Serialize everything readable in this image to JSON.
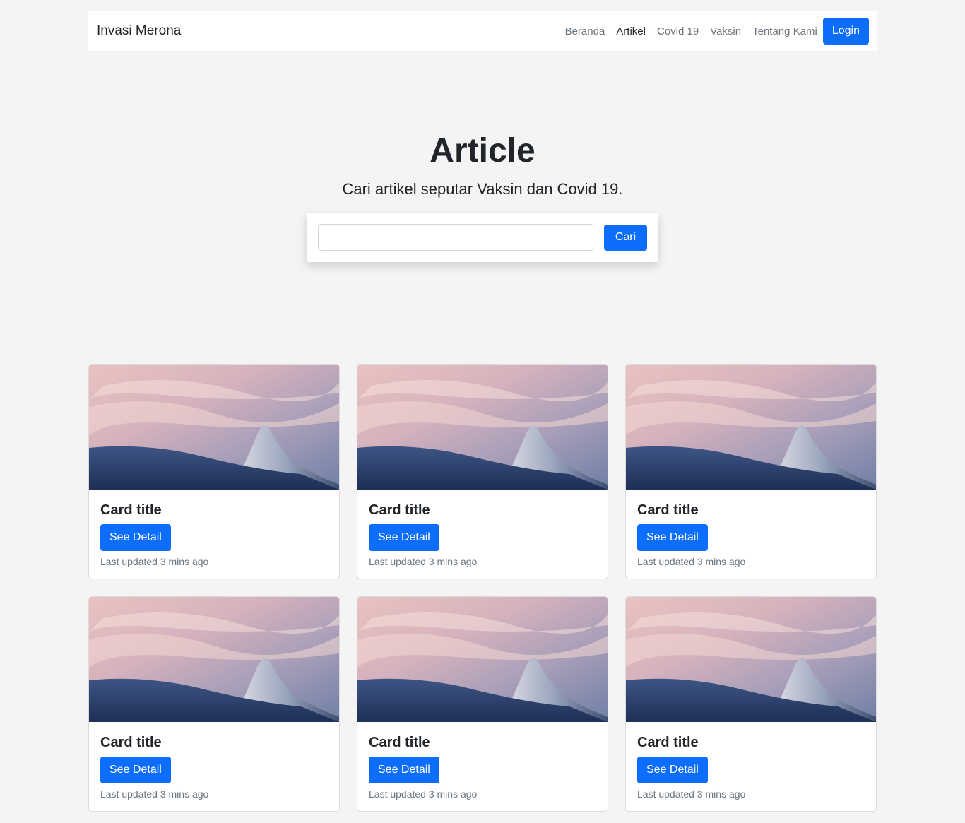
{
  "navbar": {
    "brand": "Invasi Merona",
    "links": [
      {
        "label": "Beranda",
        "active": false
      },
      {
        "label": "Artikel",
        "active": true
      },
      {
        "label": "Covid 19",
        "active": false
      },
      {
        "label": "Vaksin",
        "active": false
      },
      {
        "label": "Tentang Kami",
        "active": false
      }
    ],
    "login_label": "Login"
  },
  "hero": {
    "title": "Article",
    "subtitle": "Cari artikel seputar Vaksin dan Covid 19.",
    "search_value": "",
    "search_button": "Cari"
  },
  "cards": [
    {
      "title": "Card title",
      "button": "See Detail",
      "meta": "Last updated 3 mins ago"
    },
    {
      "title": "Card title",
      "button": "See Detail",
      "meta": "Last updated 3 mins ago"
    },
    {
      "title": "Card title",
      "button": "See Detail",
      "meta": "Last updated 3 mins ago"
    },
    {
      "title": "Card title",
      "button": "See Detail",
      "meta": "Last updated 3 mins ago"
    },
    {
      "title": "Card title",
      "button": "See Detail",
      "meta": "Last updated 3 mins ago"
    },
    {
      "title": "Card title",
      "button": "See Detail",
      "meta": "Last updated 3 mins ago"
    }
  ],
  "colors": {
    "primary": "#0d6efd",
    "page_background": "#f4f4f4",
    "muted_text": "#6c757d"
  }
}
